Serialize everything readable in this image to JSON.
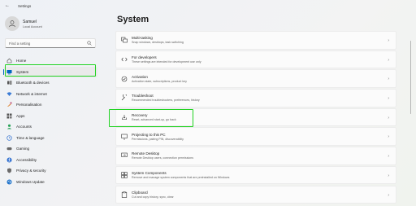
{
  "window": {
    "title": "Settings"
  },
  "user": {
    "name": "Samuel",
    "account": "Local Account"
  },
  "search": {
    "placeholder": "Find a setting"
  },
  "sidebar": {
    "items": [
      {
        "label": "Home",
        "icon": "home-icon",
        "active": false
      },
      {
        "label": "System",
        "icon": "system-icon",
        "active": true
      },
      {
        "label": "Bluetooth & devices",
        "icon": "bluetooth-icon",
        "active": false
      },
      {
        "label": "Network & internet",
        "icon": "network-icon",
        "active": false
      },
      {
        "label": "Personalisation",
        "icon": "brush-icon",
        "active": false
      },
      {
        "label": "Apps",
        "icon": "apps-icon",
        "active": false
      },
      {
        "label": "Accounts",
        "icon": "accounts-icon",
        "active": false
      },
      {
        "label": "Time & language",
        "icon": "time-language-icon",
        "active": false
      },
      {
        "label": "Gaming",
        "icon": "gaming-icon",
        "active": false
      },
      {
        "label": "Accessibility",
        "icon": "accessibility-icon",
        "active": false
      },
      {
        "label": "Privacy & security",
        "icon": "shield-icon",
        "active": false
      },
      {
        "label": "Windows Update",
        "icon": "update-icon",
        "active": false
      }
    ]
  },
  "main": {
    "title": "System",
    "rows": [
      {
        "title": "Multi-tasking",
        "subtitle": "Snap windows, desktops, task switching",
        "icon": "multitasking-icon"
      },
      {
        "title": "For developers",
        "subtitle": "These settings are intended for development use only",
        "icon": "developer-icon"
      },
      {
        "title": "Activation",
        "subtitle": "Activation state, subscriptions, product key",
        "icon": "activation-icon"
      },
      {
        "title": "Troubleshoot",
        "subtitle": "Recommended troubleshooters, preferences, history",
        "icon": "troubleshoot-icon"
      },
      {
        "title": "Recovery",
        "subtitle": "Reset, advanced start-up, go back",
        "icon": "recovery-icon"
      },
      {
        "title": "Projecting to this PC",
        "subtitle": "Permissions, pairing PIN, discoverability",
        "icon": "projecting-icon"
      },
      {
        "title": "Remote Desktop",
        "subtitle": "Remote Desktop users, connection permissions",
        "icon": "remote-desktop-icon"
      },
      {
        "title": "System Components",
        "subtitle": "Remove and manage system components that are preinstalled on Windows",
        "icon": "components-icon"
      },
      {
        "title": "Clipboard",
        "subtitle": "Cut and copy history, sync, clear",
        "icon": "clipboard-icon"
      }
    ]
  },
  "colors": {
    "accent": "#0067c0",
    "highlight": "#22d322"
  }
}
